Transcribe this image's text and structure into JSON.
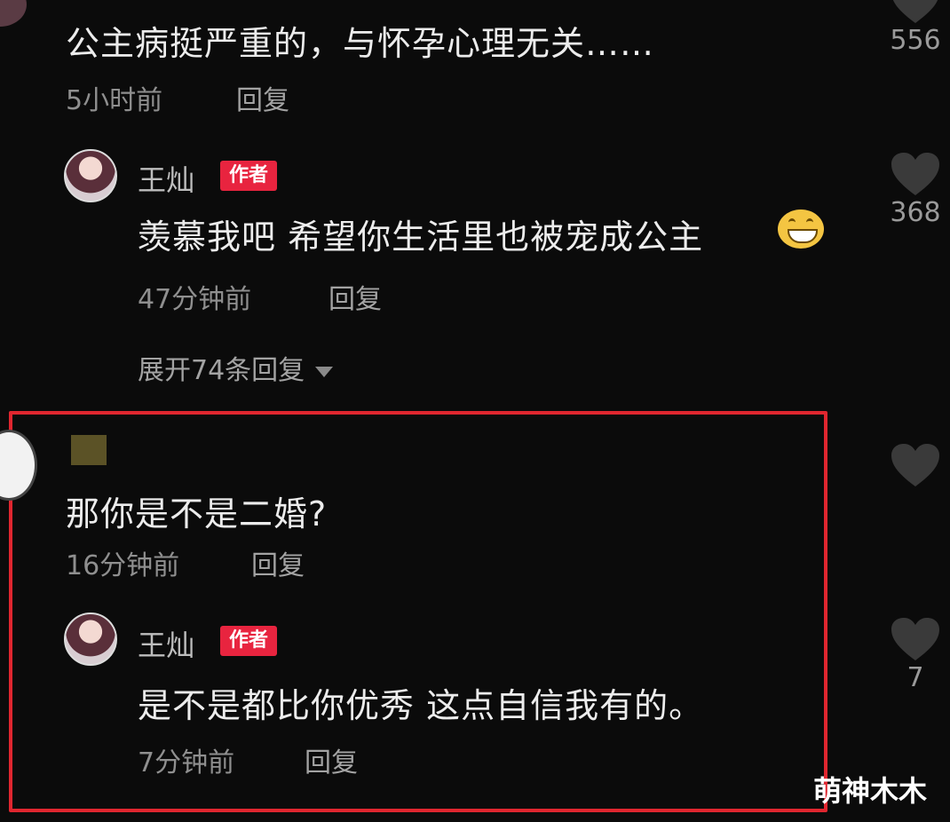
{
  "comments": [
    {
      "text": "公主病挺严重的，与怀孕心理无关……",
      "time": "5小时前",
      "reply_label": "回复",
      "likes": "556"
    },
    {
      "username": "王灿",
      "badge": "作者",
      "text": "羡慕我吧 希望你生活里也被宠成公主",
      "time": "47分钟前",
      "reply_label": "回复",
      "likes": "368"
    }
  ],
  "expand_replies": "展开74条回复",
  "highlighted": {
    "comment": {
      "text": "那你是不是二婚?",
      "time": "16分钟前",
      "reply_label": "回复"
    },
    "reply": {
      "username": "王灿",
      "badge": "作者",
      "text": "是不是都比你优秀 这点自信我有的。",
      "time": "7分钟前",
      "reply_label": "回复",
      "likes": "7"
    }
  },
  "watermark": "萌神木木",
  "colors": {
    "background": "#0b0b0b",
    "badge": "#e8243f",
    "highlight_border": "#e0262f"
  },
  "icons": {
    "like": "heart-icon",
    "expand": "caret-down-icon"
  }
}
